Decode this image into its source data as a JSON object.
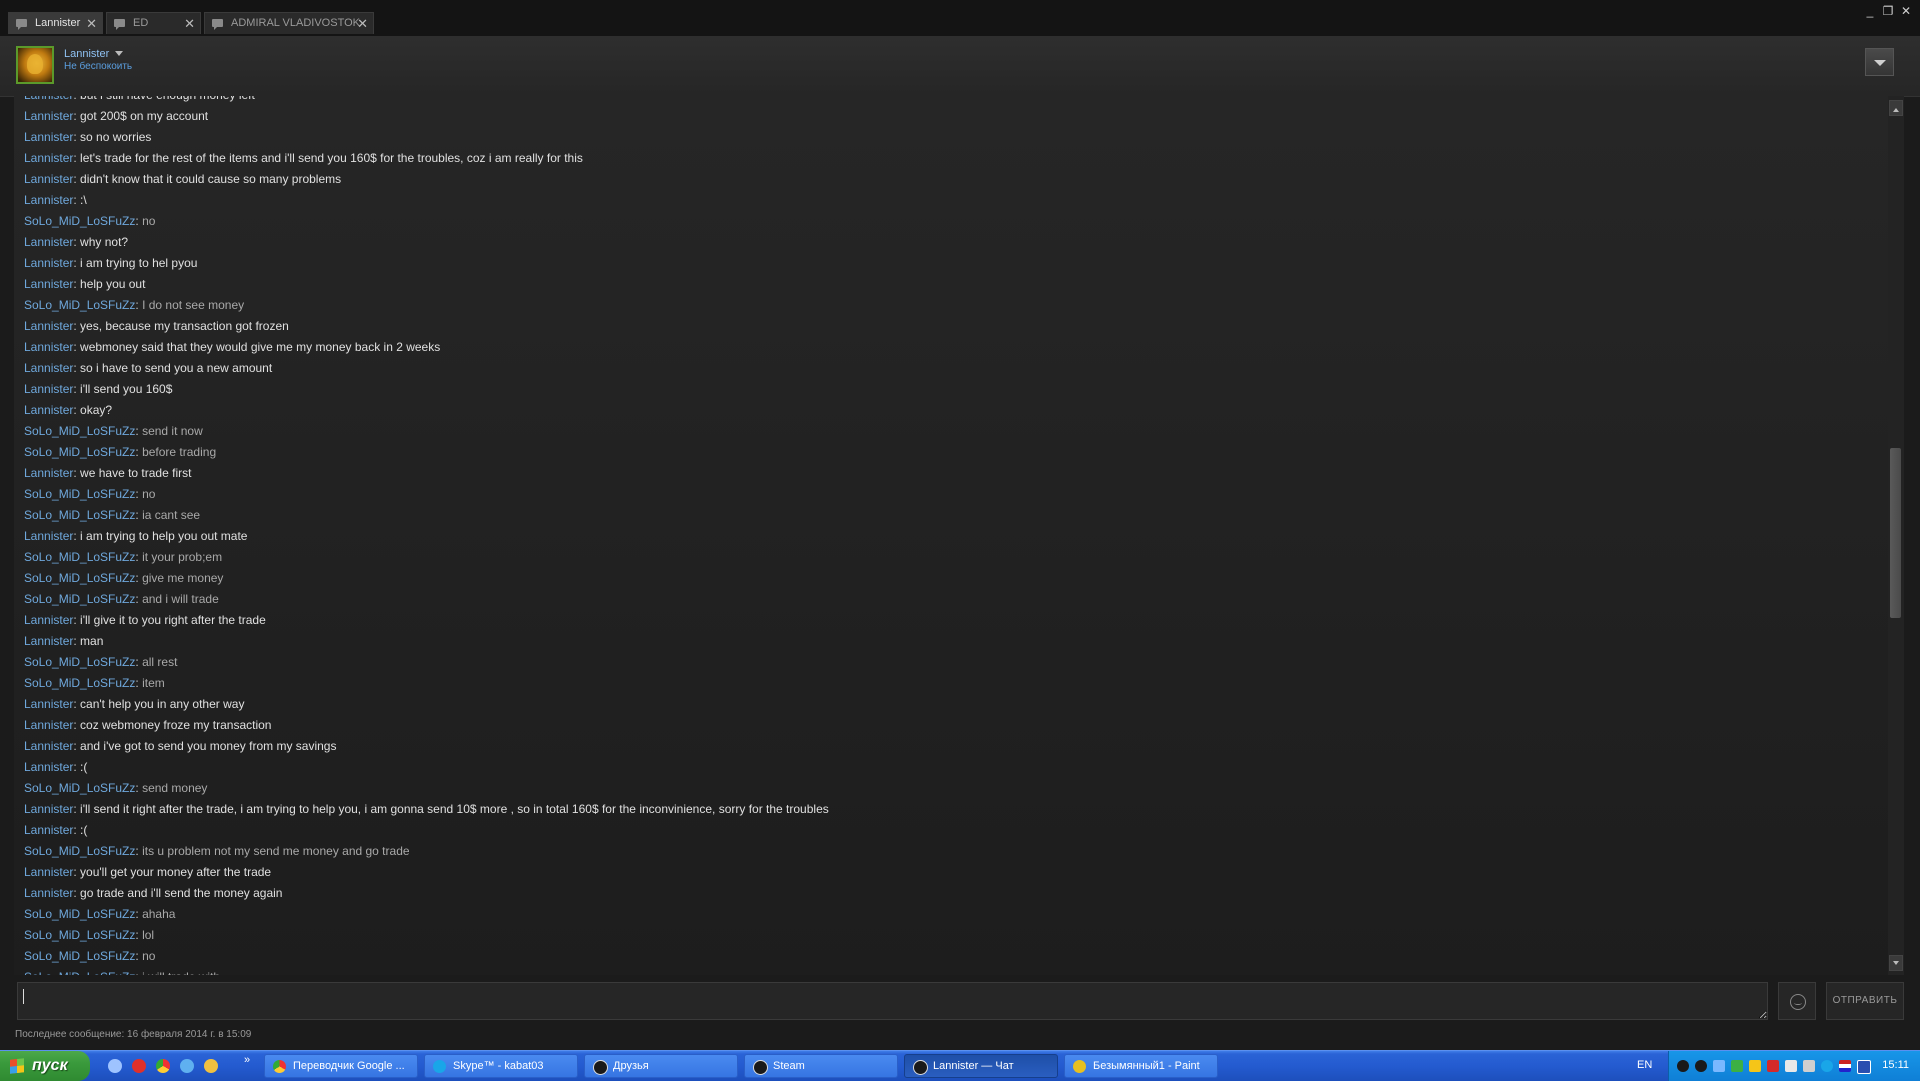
{
  "tabs": [
    {
      "label": "Lannister",
      "active": true
    },
    {
      "label": "ED",
      "active": false
    },
    {
      "label": "ADMIRAL VLADIVOSTOK",
      "active": false
    }
  ],
  "window_controls": {
    "minimize": "_",
    "restore": "❐",
    "close": "✕"
  },
  "header": {
    "name": "Lannister",
    "status": "Не беспокоить"
  },
  "messages": [
    {
      "author": "Lannister",
      "text": "but i still have enough money left",
      "role": "me"
    },
    {
      "author": "Lannister",
      "text": "got 200$ on my account",
      "role": "me"
    },
    {
      "author": "Lannister",
      "text": "so no worries",
      "role": "me"
    },
    {
      "author": "Lannister",
      "text": "let's trade for the rest of the items and i'll send you 160$ for the troubles, coz i am really for this",
      "role": "me"
    },
    {
      "author": "Lannister",
      "text": "didn't know that it could cause so many problems",
      "role": "me"
    },
    {
      "author": "Lannister",
      "text": ":\\",
      "role": "me"
    },
    {
      "author": "SoLo_MiD_LoSFuZz",
      "text": "no",
      "role": "them"
    },
    {
      "author": "Lannister",
      "text": "why not?",
      "role": "me"
    },
    {
      "author": "Lannister",
      "text": "i am trying to hel pyou",
      "role": "me"
    },
    {
      "author": "Lannister",
      "text": "help you out",
      "role": "me"
    },
    {
      "author": "SoLo_MiD_LoSFuZz",
      "text": "I do not see money",
      "role": "them"
    },
    {
      "author": "Lannister",
      "text": "yes, because my transaction got frozen",
      "role": "me"
    },
    {
      "author": "Lannister",
      "text": "webmoney said that they would give me my money back in 2 weeks",
      "role": "me"
    },
    {
      "author": "Lannister",
      "text": "so i have to send you a new amount",
      "role": "me"
    },
    {
      "author": "Lannister",
      "text": "i'll send you 160$",
      "role": "me"
    },
    {
      "author": "Lannister",
      "text": "okay?",
      "role": "me"
    },
    {
      "author": "SoLo_MiD_LoSFuZz",
      "text": "send it now",
      "role": "them"
    },
    {
      "author": "SoLo_MiD_LoSFuZz",
      "text": "before trading",
      "role": "them"
    },
    {
      "author": "Lannister",
      "text": "we have to trade first",
      "role": "me"
    },
    {
      "author": "SoLo_MiD_LoSFuZz",
      "text": "no",
      "role": "them"
    },
    {
      "author": "SoLo_MiD_LoSFuZz",
      "text": "ia cant see",
      "role": "them"
    },
    {
      "author": "Lannister",
      "text": "i am trying to help you out mate",
      "role": "me"
    },
    {
      "author": "SoLo_MiD_LoSFuZz",
      "text": "it your prob;em",
      "role": "them"
    },
    {
      "author": "SoLo_MiD_LoSFuZz",
      "text": "give me money",
      "role": "them"
    },
    {
      "author": "SoLo_MiD_LoSFuZz",
      "text": "and i will trade",
      "role": "them"
    },
    {
      "author": "Lannister",
      "text": "i'll give it to you right after the trade",
      "role": "me"
    },
    {
      "author": "Lannister",
      "text": "man",
      "role": "me"
    },
    {
      "author": "SoLo_MiD_LoSFuZz",
      "text": "all rest",
      "role": "them"
    },
    {
      "author": "SoLo_MiD_LoSFuZz",
      "text": "item",
      "role": "them"
    },
    {
      "author": "Lannister",
      "text": "can't help you in any other way",
      "role": "me"
    },
    {
      "author": "Lannister",
      "text": "coz webmoney froze my transaction",
      "role": "me"
    },
    {
      "author": "Lannister",
      "text": "and i've got to send you money from my savings",
      "role": "me"
    },
    {
      "author": "Lannister",
      "text": ":(",
      "role": "me"
    },
    {
      "author": "SoLo_MiD_LoSFuZz",
      "text": "send money",
      "role": "them"
    },
    {
      "author": "Lannister",
      "text": "i'll send it right after the trade, i am trying to help you, i am gonna send 10$ more , so in total 160$ for the inconvinience, sorry for the troubles",
      "role": "me"
    },
    {
      "author": "Lannister",
      "text": ":(",
      "role": "me"
    },
    {
      "author": "SoLo_MiD_LoSFuZz",
      "text": "its u problem not my send me money and go trade",
      "role": "them"
    },
    {
      "author": "Lannister",
      "text": "you'll get your money after the trade",
      "role": "me"
    },
    {
      "author": "Lannister",
      "text": "go trade and i'll send the money again",
      "role": "me"
    },
    {
      "author": "SoLo_MiD_LoSFuZz",
      "text": "ahaha",
      "role": "them"
    },
    {
      "author": "SoLo_MiD_LoSFuZz",
      "text": "lol",
      "role": "them"
    },
    {
      "author": "SoLo_MiD_LoSFuZz",
      "text": "no",
      "role": "them"
    },
    {
      "author": "SoLo_MiD_LoSFuZz",
      "text": "i will trade with",
      "role": "them"
    }
  ],
  "input": {
    "value": "",
    "send_label": "ОТПРАВИТЬ",
    "emoticon_icon": "smiley-icon"
  },
  "footer": {
    "last_message": "Последнее сообщение: 16 февраля 2014 г. в 15:09"
  },
  "taskbar": {
    "start_label": "пуск",
    "tasks": [
      {
        "label": "Переводчик Google ...",
        "icon_color": "#e8a020"
      },
      {
        "label": "Skype™ - kabat03",
        "icon_color": "#19a6e8"
      },
      {
        "label": "Друзья",
        "icon_color": "#222222"
      },
      {
        "label": "Steam",
        "icon_color": "#222222"
      },
      {
        "label": "Lannister — Чат",
        "icon_color": "#222222",
        "active": true
      },
      {
        "label": "Безымянный1 - Paint",
        "icon_color": "#e8c020"
      }
    ],
    "lang": "EN",
    "clock": "15:11"
  },
  "colors": {
    "author_name": "#6fa8dc",
    "my_text": "#e0e0e0",
    "their_text": "#a9a9a9",
    "status_blue": "#5b9fe0",
    "taskbar_blue": "#245bd0",
    "start_green": "#3a9a3c"
  }
}
